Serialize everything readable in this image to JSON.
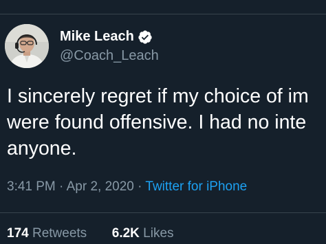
{
  "author": {
    "display_name": "Mike Leach",
    "handle": "@Coach_Leach",
    "verified": true,
    "avatar_icon": "profile-photo-icon",
    "verified_icon": "verified-badge-icon"
  },
  "tweet": {
    "lines": [
      "I sincerely regret if my choice of im",
      "were found offensive. I had no inte",
      "anyone."
    ],
    "time": "3:41 PM",
    "separator": "·",
    "date": "Apr 2, 2020",
    "source": "Twitter for iPhone"
  },
  "stats": {
    "retweets_count": "174",
    "retweets_label": "Retweets",
    "likes_count": "6.2K",
    "likes_label": "Likes"
  },
  "colors": {
    "background": "#15202b",
    "divider": "#38444d",
    "secondary_text": "#8899a6",
    "link": "#1da1f2"
  }
}
